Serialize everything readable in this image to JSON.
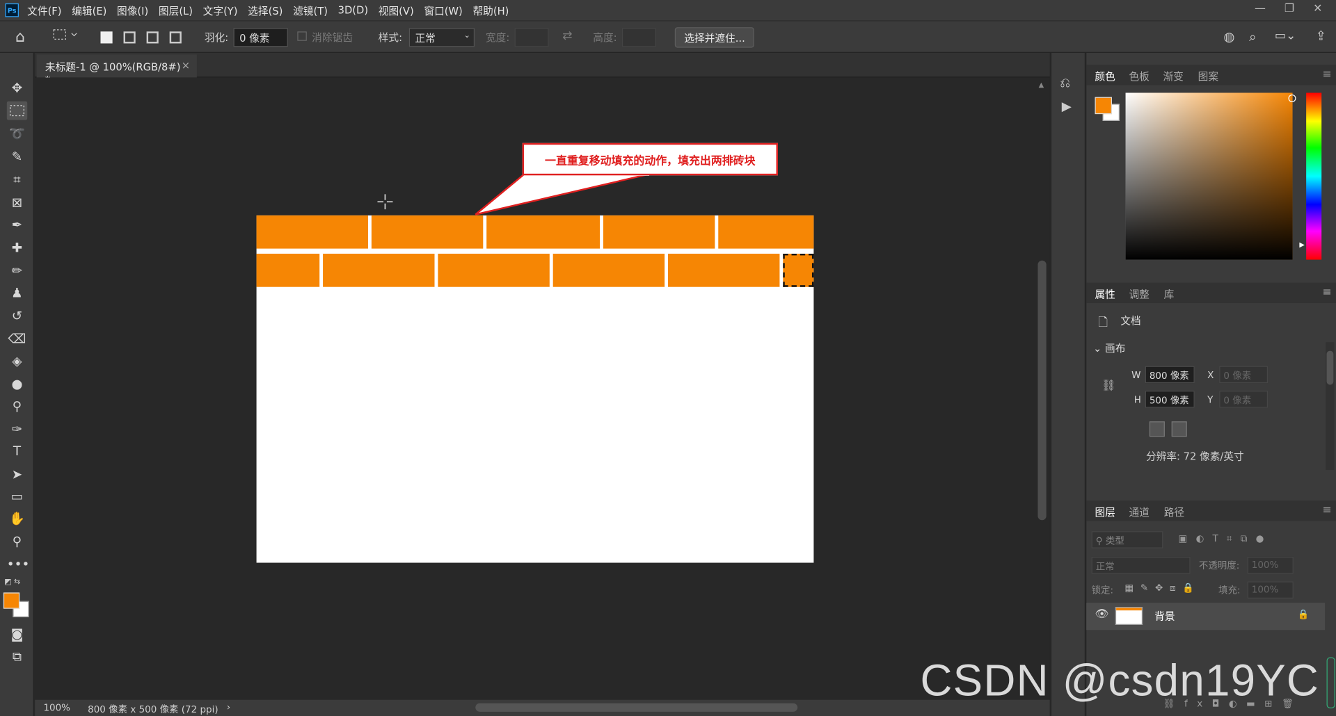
{
  "app": {
    "logo": "Ps"
  },
  "menu": [
    "文件(F)",
    "编辑(E)",
    "图像(I)",
    "图层(L)",
    "文字(Y)",
    "选择(S)",
    "滤镜(T)",
    "3D(D)",
    "视图(V)",
    "窗口(W)",
    "帮助(H)"
  ],
  "window_controls": {
    "minimize": "—",
    "restore": "❐",
    "close": "✕"
  },
  "options": {
    "feather_label": "羽化:",
    "feather_value": "0 像素",
    "antialias_label": "消除锯齿",
    "style_label": "样式:",
    "style_value": "正常",
    "width_label": "宽度:",
    "height_label": "高度:",
    "select_mask_button": "选择并遮住..."
  },
  "document": {
    "tab_title": "未标题-1 @ 100%(RGB/8#) *",
    "close": "×",
    "brick_color": "#f68604",
    "row1_bricks": 5,
    "row2_bricks": 6
  },
  "callout": {
    "text": "一直重复移动填充的动作，填充出两排砖块",
    "border_color": "#e02020"
  },
  "status": {
    "zoom": "100%",
    "info": "800 像素 x 500 像素 (72 ppi)",
    "arrow": "›"
  },
  "color_panel": {
    "tabs": [
      "颜色",
      "色板",
      "渐变",
      "图案"
    ],
    "foreground": "#f68604",
    "background": "#ffffff"
  },
  "properties_panel": {
    "tabs": [
      "属性",
      "调整",
      "库"
    ],
    "doc_label": "文档",
    "section": "画布",
    "w_label": "W",
    "w_value": "800 像素",
    "h_label": "H",
    "h_value": "500 像素",
    "x_label": "X",
    "x_placeholder": "0 像素",
    "y_label": "Y",
    "y_placeholder": "0 像素",
    "resolution": "分辨率: 72 像素/英寸"
  },
  "layers_panel": {
    "tabs": [
      "图层",
      "通道",
      "路径"
    ],
    "filter_placeholder": "类型",
    "blend_mode": "正常",
    "opacity_label": "不透明度:",
    "opacity_value": "100%",
    "lock_label": "锁定:",
    "fill_label": "填充:",
    "fill_value": "100%",
    "layers": [
      {
        "name": "背景",
        "visible": true,
        "locked": true
      }
    ]
  },
  "watermark": "CSDN @csdn19YC"
}
